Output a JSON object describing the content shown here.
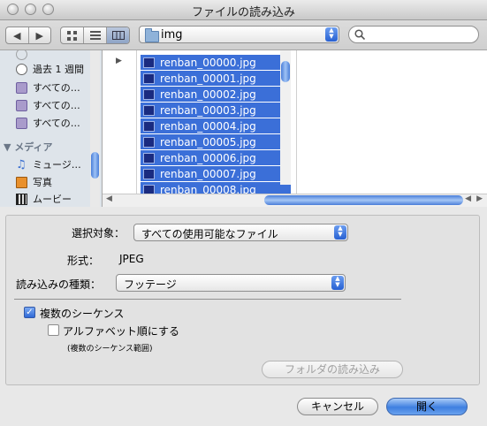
{
  "window": {
    "title": "ファイルの読み込み"
  },
  "toolbar": {
    "back_glyph": "◀",
    "forward_glyph": "▶",
    "location": "img",
    "search_value": ""
  },
  "sidebar": {
    "items": [
      {
        "label": "過去 1 週間",
        "icon": "clock-icon"
      },
      {
        "label": "すべての…",
        "icon": "smart-folder-icon"
      },
      {
        "label": "すべての…",
        "icon": "smart-folder-icon"
      },
      {
        "label": "すべての…",
        "icon": "smart-folder-icon"
      }
    ],
    "media_header": "メディア",
    "media_items": [
      {
        "label": "ミュージ…",
        "icon": "music-icon"
      },
      {
        "label": "写真",
        "icon": "photo-icon"
      },
      {
        "label": "ムービー",
        "icon": "movie-icon"
      }
    ]
  },
  "browser": {
    "files": [
      "renban_00000.jpg",
      "renban_00001.jpg",
      "renban_00002.jpg",
      "renban_00003.jpg",
      "renban_00004.jpg",
      "renban_00005.jpg",
      "renban_00006.jpg",
      "renban_00007.jpg",
      "renban_00008.jpg"
    ]
  },
  "options": {
    "enable_label": "選択対象：",
    "enable_value": "すべての使用可能なファイル",
    "format_label": "形式：",
    "format_value": "JPEG",
    "import_as_label": "読み込みの種類：",
    "import_as_value": "フッテージ",
    "sequence_label": "複数のシーケンス",
    "sequence_checked": true,
    "alpha_label": "アルファベット順にする",
    "alpha_checked": false,
    "range_note": "(複数のシーケンス範囲)",
    "folder_button": "フォルダの読み込み"
  },
  "buttons": {
    "cancel": "キャンセル",
    "open": "開く"
  },
  "colors": {
    "selection": "#3b6fd8",
    "accent": "#3e7fe0"
  }
}
